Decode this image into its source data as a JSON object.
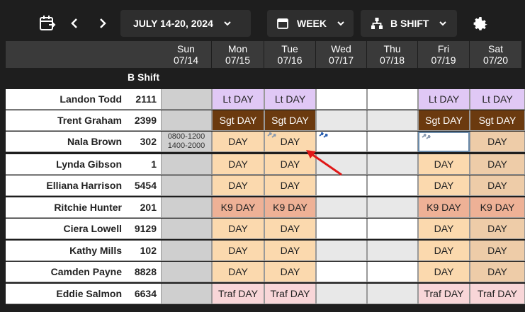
{
  "toolbar": {
    "date_range": "JULY 14-20, 2024",
    "view": "WEEK",
    "shift": "B SHIFT"
  },
  "days": [
    {
      "dow": "Sun",
      "date": "07/14"
    },
    {
      "dow": "Mon",
      "date": "07/15"
    },
    {
      "dow": "Tue",
      "date": "07/16"
    },
    {
      "dow": "Wed",
      "date": "07/17"
    },
    {
      "dow": "Thu",
      "date": "07/18"
    },
    {
      "dow": "Fri",
      "date": "07/19"
    },
    {
      "dow": "Sat",
      "date": "07/20"
    }
  ],
  "shift_label": "B Shift",
  "rows": [
    {
      "name": "Landon Todd",
      "num": "2111",
      "cells": [
        "",
        "Lt DAY",
        "Lt DAY",
        "",
        "",
        "Lt DAY",
        "Lt DAY"
      ]
    },
    {
      "name": "Trent Graham",
      "num": "2399",
      "cells": [
        "",
        "Sgt DAY",
        "Sgt DAY",
        "",
        "",
        "Sgt DAY",
        "Sgt DAY"
      ]
    },
    {
      "name": "Nala Brown",
      "num": "302",
      "cells": [
        "0800-1200",
        "DAY",
        "DAY",
        "",
        "",
        "",
        "DAY"
      ],
      "sun_line2": "1400-2000"
    },
    {
      "name": "Lynda Gibson",
      "num": "1",
      "cells": [
        "",
        "DAY",
        "DAY",
        "",
        "",
        "DAY",
        "DAY"
      ]
    },
    {
      "name": "Elliana Harrison",
      "num": "5454",
      "cells": [
        "",
        "DAY",
        "DAY",
        "",
        "",
        "DAY",
        "DAY"
      ]
    },
    {
      "name": "Ritchie Hunter",
      "num": "201",
      "cells": [
        "",
        "K9 DAY",
        "K9 DAY",
        "",
        "",
        "K9 DAY",
        "K9 DAY"
      ]
    },
    {
      "name": "Ciera Lowell",
      "num": "9129",
      "cells": [
        "",
        "DAY",
        "DAY",
        "",
        "",
        "DAY",
        "DAY"
      ]
    },
    {
      "name": "Kathy Mills",
      "num": "102",
      "cells": [
        "",
        "DAY",
        "DAY",
        "",
        "",
        "DAY",
        "DAY"
      ]
    },
    {
      "name": "Camden Payne",
      "num": "8828",
      "cells": [
        "",
        "DAY",
        "DAY",
        "",
        "",
        "DAY",
        "DAY"
      ]
    },
    {
      "name": "Eddie Salmon",
      "num": "6634",
      "cells": [
        "",
        "Traf DAY",
        "Traf DAY",
        "",
        "",
        "Traf DAY",
        "Traf DAY"
      ]
    }
  ],
  "colors": {
    "lt": "#e0c8f5",
    "sgt": "#6b3a0f",
    "day": "#fbd9ae",
    "k9": "#eeb196",
    "traf": "#f8d6d8",
    "annotation_arrow": "#e01818"
  }
}
